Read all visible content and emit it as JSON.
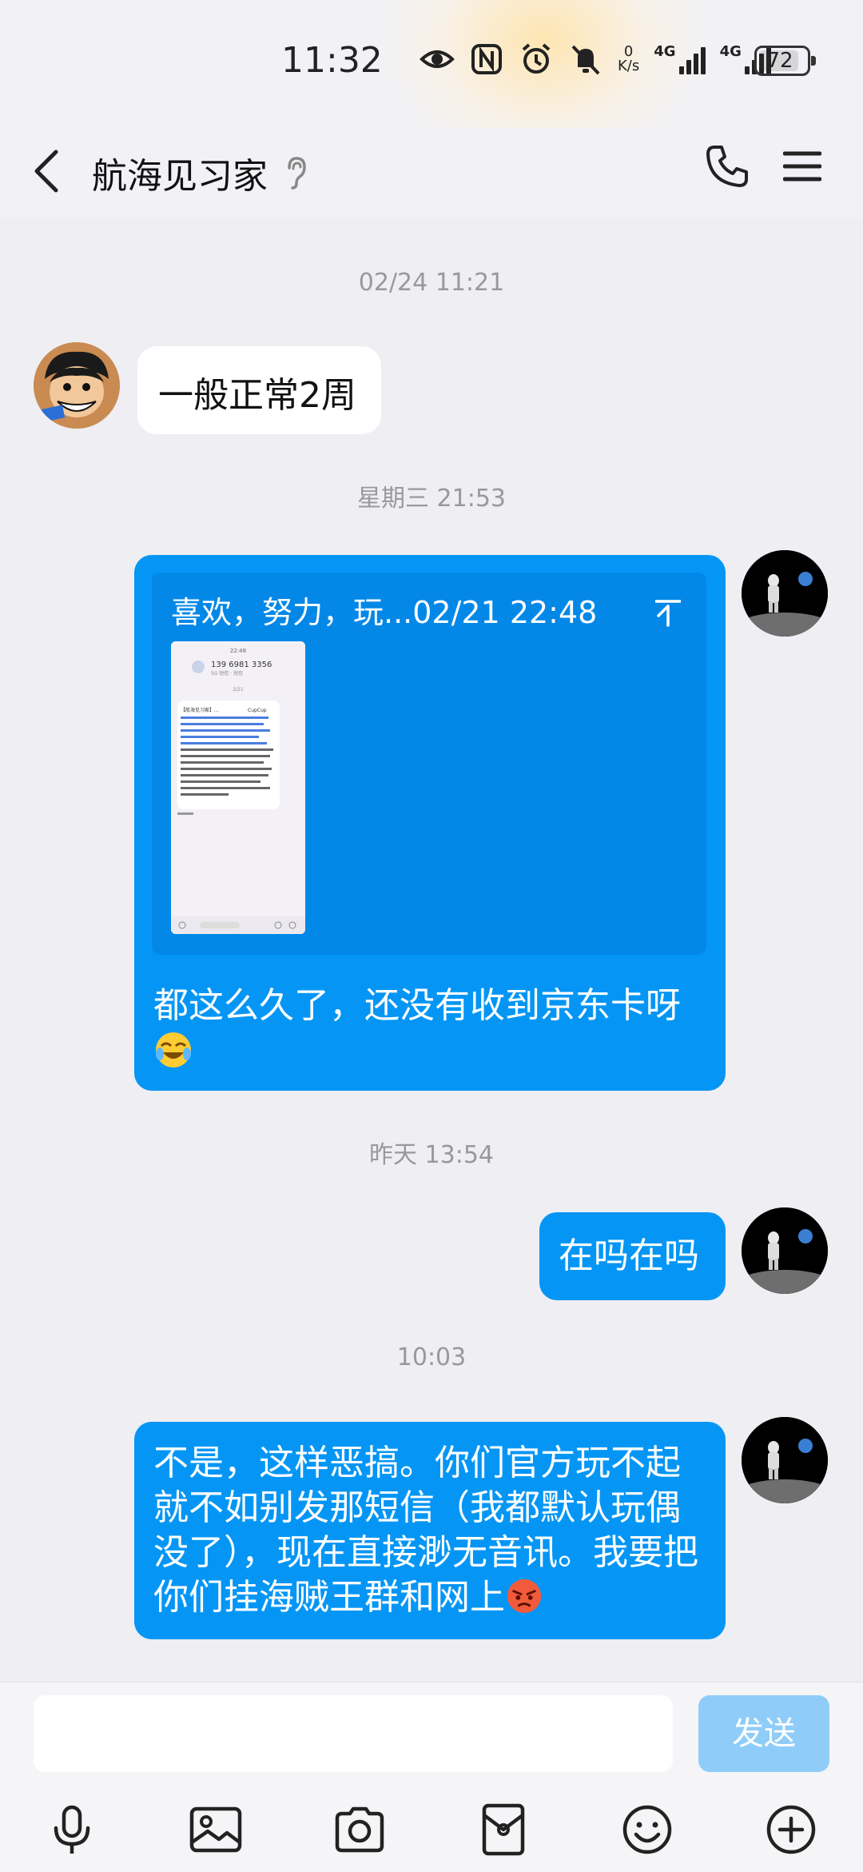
{
  "status_bar": {
    "time": "11:32",
    "net_speed_value": "0",
    "net_speed_unit": "K/s",
    "sim1_label": "4G",
    "sim2_label": "4G",
    "battery": "72"
  },
  "header": {
    "title": "航海见习家"
  },
  "messages": [
    {
      "timestamp": "02/24 11:21"
    },
    {
      "incoming_text": "一般正常2周"
    },
    {
      "timestamp": "星期三 21:53"
    },
    {
      "quote_header": "喜欢，努力，玩...02/21 22:48",
      "quote_image_lines": [
        "22:48",
        "139 6981 3356",
        "5G 短信 · 短信",
        "2/21",
        "【航海见习家】…",
        "CupCup"
      ],
      "outgoing_text": "都这么久了，还没有收到京东卡呀"
    },
    {
      "timestamp": "昨天 13:54"
    },
    {
      "outgoing_text": "在吗在吗"
    },
    {
      "timestamp": "10:03"
    },
    {
      "outgoing_text": "不是，这样恶搞。你们官方玩不起就不如别发那短信（我都默认玩偶没了），现在直接渺无音讯。我要把你们挂海贼王群和网上"
    }
  ],
  "input": {
    "value": "",
    "send_label": "发送"
  },
  "toolbar": [
    "mic-icon",
    "image-icon",
    "camera-icon",
    "red-packet-icon",
    "emoji-icon",
    "plus-icon"
  ],
  "colors": {
    "accent": "#0596f5",
    "send_disabled": "#8fcdf8",
    "background": "#eeeef3"
  }
}
